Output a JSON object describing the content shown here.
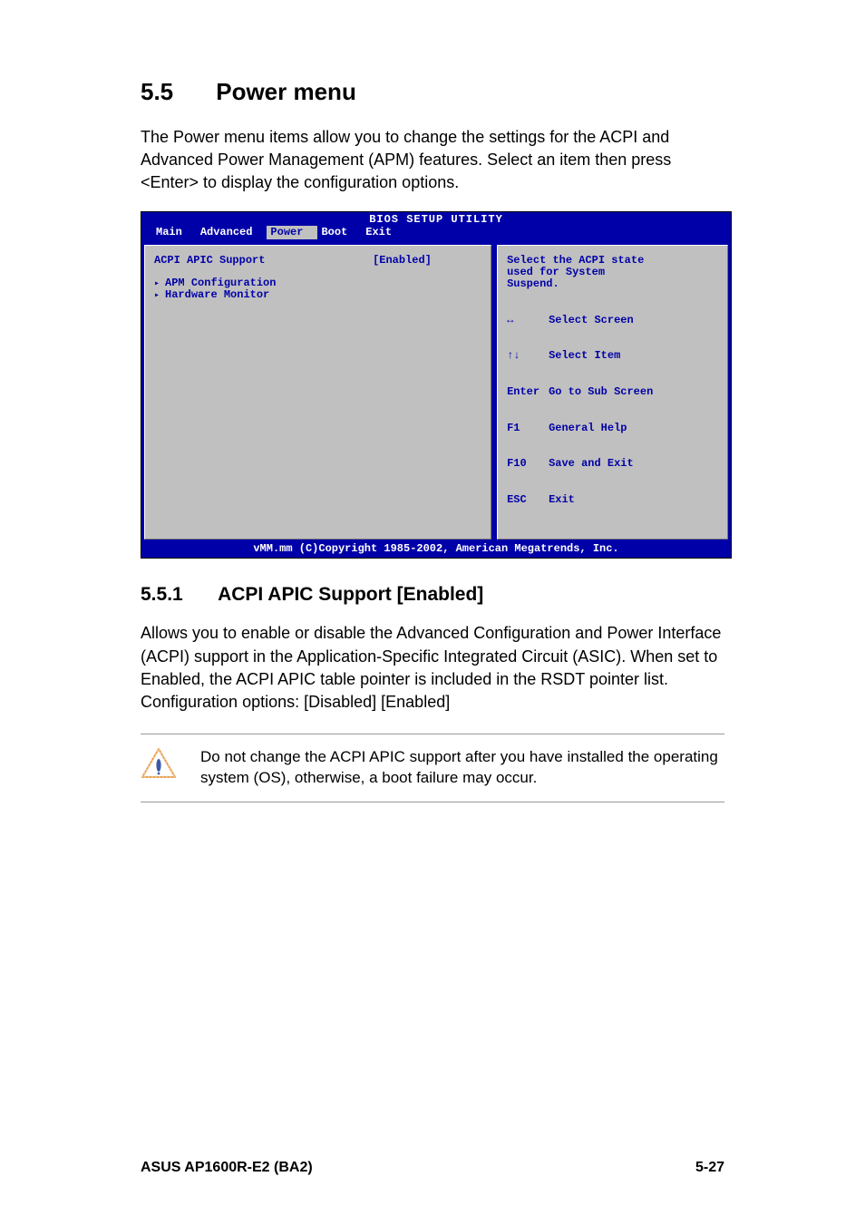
{
  "heading": {
    "number": "5.5",
    "title": "Power menu"
  },
  "intro": "The Power menu items allow you to change the settings for the ACPI and Advanced Power Management (APM) features. Select an item then press <Enter> to display the configuration options.",
  "bios": {
    "title": "BIOS SETUP UTILITY",
    "tabs": {
      "main": "Main",
      "advanced": "Advanced",
      "power": "Power",
      "boot": "Boot",
      "exit": "Exit"
    },
    "active_tab": "power",
    "option": {
      "label": "ACPI APIC Support",
      "value": "[Enabled]"
    },
    "submenus": {
      "apm": "APM Configuration",
      "hw": "Hardware Monitor"
    },
    "help": "Select the ACPI state\nused for System\nSuspend.",
    "keys": [
      {
        "k": "↔",
        "d": "Select Screen"
      },
      {
        "k": "↑↓",
        "d": "Select Item"
      },
      {
        "k": "Enter",
        "d": "Go to Sub Screen"
      },
      {
        "k": "F1",
        "d": "General Help"
      },
      {
        "k": "F10",
        "d": "Save and Exit"
      },
      {
        "k": "ESC",
        "d": "Exit"
      }
    ],
    "footer": "vMM.mm (C)Copyright 1985-2002, American Megatrends, Inc."
  },
  "subheading": {
    "number": "5.5.1",
    "title": "ACPI APIC Support [Enabled]"
  },
  "subbody": "Allows you to enable or disable the Advanced Configuration and Power Interface (ACPI) support in the Application-Specific Integrated Circuit (ASIC). When set to Enabled, the ACPI APIC table pointer is included in the RSDT pointer list. Configuration options: [Disabled] [Enabled]",
  "note": "Do not change the ACPI APIC support after you have installed the operating system (OS), otherwise, a boot failure may occur.",
  "pgfooter": {
    "left": "ASUS AP1600R-E2 (BA2)",
    "right": "5-27"
  }
}
